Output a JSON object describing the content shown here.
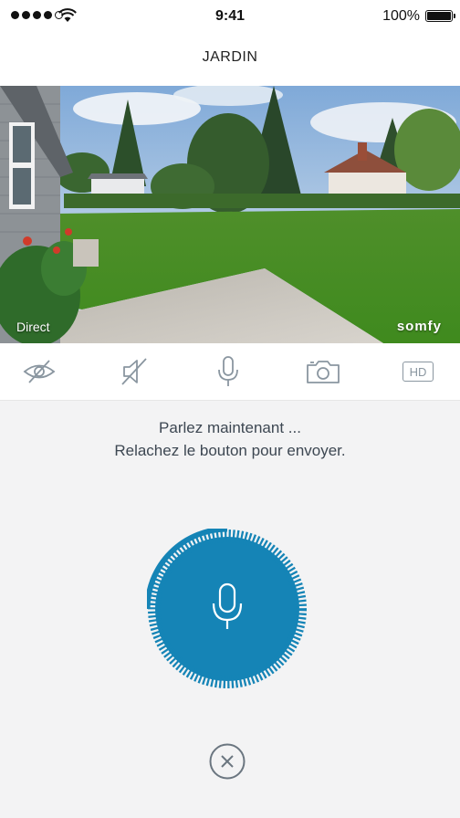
{
  "status_bar": {
    "time": "9:41",
    "battery": "100%"
  },
  "header": {
    "title": "JARDIN"
  },
  "camera": {
    "live_label": "Direct",
    "brand": "somfy"
  },
  "toolbar": {
    "items": [
      {
        "icon": "eye-slash-icon"
      },
      {
        "icon": "speaker-mute-icon"
      },
      {
        "icon": "microphone-icon"
      },
      {
        "icon": "camera-icon"
      },
      {
        "icon": "hd-icon",
        "label": "HD"
      }
    ]
  },
  "talk": {
    "line1": "Parlez maintenant ...",
    "line2": "Relachez le bouton pour envoyer."
  },
  "colors": {
    "accent": "#1584b6",
    "icon_gray": "#8a96a0",
    "background": "#f3f3f4"
  }
}
